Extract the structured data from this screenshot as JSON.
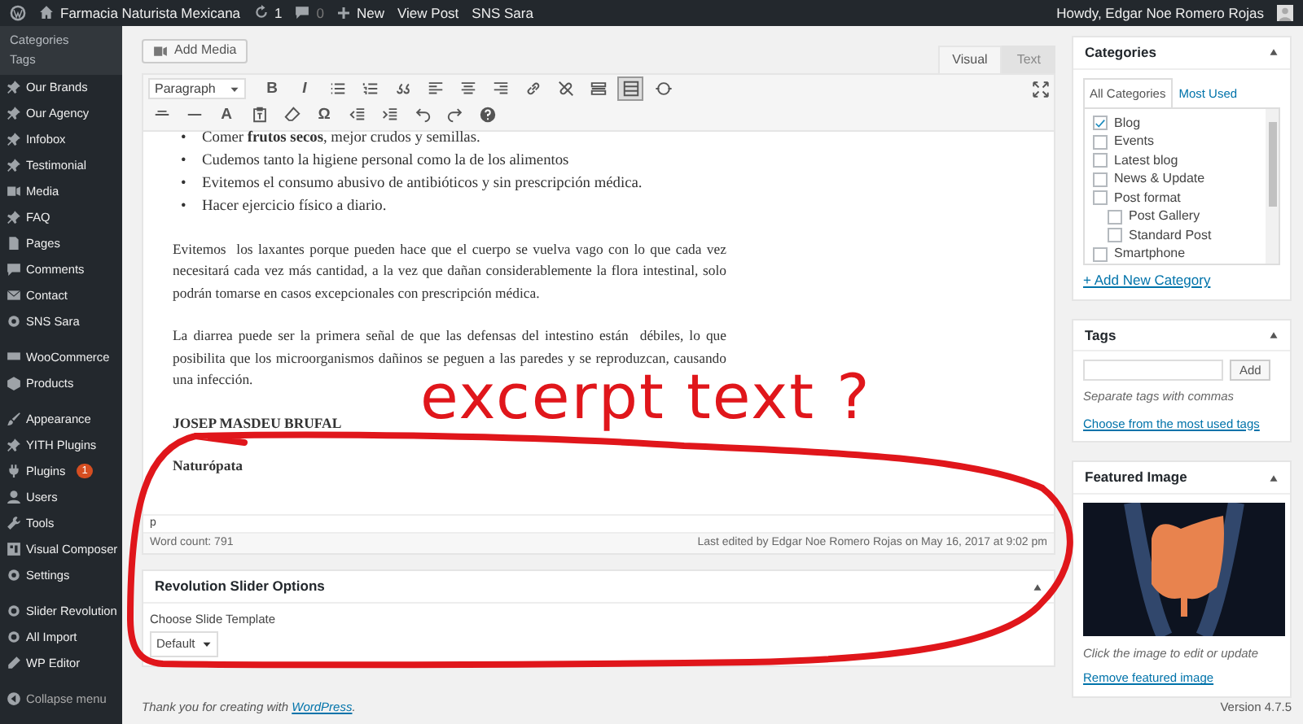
{
  "admin_bar": {
    "site_name": "Farmacia Naturista Mexicana",
    "updates_count": "1",
    "comments_count": "0",
    "new_label": "New",
    "links": [
      "View Post",
      "SNS Sara"
    ],
    "greeting": "Howdy, Edgar Noe Romero Rojas"
  },
  "sidebar": {
    "submenu": [
      "Categories",
      "Tags"
    ],
    "groups": [
      [
        {
          "label": "Our Brands"
        },
        {
          "label": "Our Agency"
        },
        {
          "label": "Infobox"
        },
        {
          "label": "Testimonial"
        },
        {
          "label": "Media"
        },
        {
          "label": "FAQ"
        },
        {
          "label": "Pages"
        },
        {
          "label": "Comments"
        },
        {
          "label": "Contact"
        },
        {
          "label": "SNS Sara"
        }
      ],
      [
        {
          "label": "WooCommerce"
        },
        {
          "label": "Products"
        }
      ],
      [
        {
          "label": "Appearance"
        },
        {
          "label": "YITH Plugins"
        },
        {
          "label": "Plugins",
          "badge": "1"
        },
        {
          "label": "Users"
        },
        {
          "label": "Tools"
        },
        {
          "label": "Visual Composer"
        },
        {
          "label": "Settings"
        }
      ],
      [
        {
          "label": "Slider Revolution"
        },
        {
          "label": "All Import"
        },
        {
          "label": "WP Editor"
        }
      ]
    ],
    "collapse": "Collapse menu"
  },
  "editor": {
    "add_media": "Add Media",
    "tabs": [
      {
        "label": "Visual",
        "selected": true
      },
      {
        "label": "Text",
        "selected": false
      }
    ],
    "toolbar": {
      "format": "Paragraph",
      "rows": [
        [
          {
            "kind": "glyph",
            "label": "B",
            "selected": false
          },
          {
            "kind": "glyph",
            "label": "I",
            "selected": false
          },
          {
            "kind": "icon",
            "selected": false
          },
          {
            "kind": "icon",
            "selected": false
          },
          {
            "kind": "icon",
            "selected": false
          },
          {
            "kind": "icon",
            "selected": false
          },
          {
            "kind": "icon",
            "selected": false
          },
          {
            "kind": "icon",
            "selected": false
          },
          {
            "kind": "icon",
            "selected": false
          },
          {
            "kind": "icon",
            "selected": false
          },
          {
            "kind": "icon",
            "selected": false
          },
          {
            "kind": "icon",
            "selected": true
          },
          {
            "kind": "icon",
            "selected": false
          }
        ],
        [
          {
            "kind": "icon",
            "selected": false
          },
          {
            "kind": "icon",
            "selected": false
          },
          {
            "kind": "glyph",
            "label": "A",
            "selected": false
          },
          {
            "kind": "icon",
            "selected": false
          },
          {
            "kind": "icon",
            "selected": false
          },
          {
            "kind": "glyph",
            "label": "Ω",
            "selected": false
          },
          {
            "kind": "icon",
            "selected": false
          },
          {
            "kind": "icon",
            "selected": false
          },
          {
            "kind": "icon",
            "selected": false
          },
          {
            "kind": "icon",
            "selected": false
          },
          {
            "kind": "icon",
            "selected": false
          }
        ]
      ]
    },
    "list": [
      {
        "marker": "•",
        "text": "Comer **frutos secos**, mejor crudos y semillas."
      },
      {
        "marker": "•",
        "text": "Cudemos tanto la higiene personal como la de los alimentos"
      },
      {
        "marker": "•",
        "text": "Evitemos el consumo abusivo de antibióticos y sin prescripción médica."
      },
      {
        "marker": "•",
        "text": "Hacer ejercicio físico a diario."
      }
    ],
    "blocks": [
      {
        "kind": "p",
        "lines": [
          "Evitemos  los laxantes porque pueden hace que el cuerpo se vuelva vago con lo que cada vez",
          "necesitará cada vez más cantidad, a la vez que dañan considerablemente la flora intestinal, solo",
          "podrán tomarse en casos excepcionales con prescripción médica."
        ]
      },
      {
        "kind": "p",
        "lines": [
          "La diarrea puede ser la primera señal de que las defensas del intestino están  débiles, lo que",
          "posibilita que los microorganismos dañinos se peguen a las paredes y se reproduzcan, causando",
          "una infección."
        ]
      },
      {
        "kind": "strong",
        "lines": [
          "JOSEP MASDEU BRUFAL"
        ]
      },
      {
        "kind": "strong",
        "lines": [
          "Naturópata"
        ]
      }
    ],
    "path": "p",
    "word_count": "Word count: 791",
    "last_edited": "Last edited by Edgar Noe Romero Rojas on May 16, 2017 at 9:02 pm"
  },
  "revolution": {
    "title": "Revolution Slider Options",
    "label": "Choose Slide Template",
    "select": "Default"
  },
  "categories": {
    "title": "Categories",
    "tabs": [
      {
        "label": "All Categories",
        "selected": true
      },
      {
        "label": "Most Used",
        "selected": false
      }
    ],
    "items": [
      {
        "label": "Blog",
        "checked": true
      },
      {
        "label": "Events",
        "checked": false
      },
      {
        "label": "Latest blog",
        "checked": false
      },
      {
        "label": "News & Update",
        "checked": false
      },
      {
        "label": "Post format",
        "checked": false,
        "children": [
          {
            "label": "Post Gallery",
            "checked": false
          },
          {
            "label": "Standard Post",
            "checked": false
          }
        ]
      },
      {
        "label": "Smartphone",
        "checked": false
      }
    ],
    "add_link": "+ Add New Category"
  },
  "tags": {
    "title": "Tags",
    "button": "Add",
    "hint": "Separate tags with commas",
    "link": "Choose from the most used tags"
  },
  "featured": {
    "title": "Featured Image",
    "caption": "Click the image to edit or update",
    "link": "Remove featured image"
  },
  "footer": {
    "text": "Thank you for creating with ",
    "link": "WordPress",
    "end": ".",
    "version": "Version 4.7.5"
  },
  "annotation": {
    "text": "excerpt text ?"
  }
}
